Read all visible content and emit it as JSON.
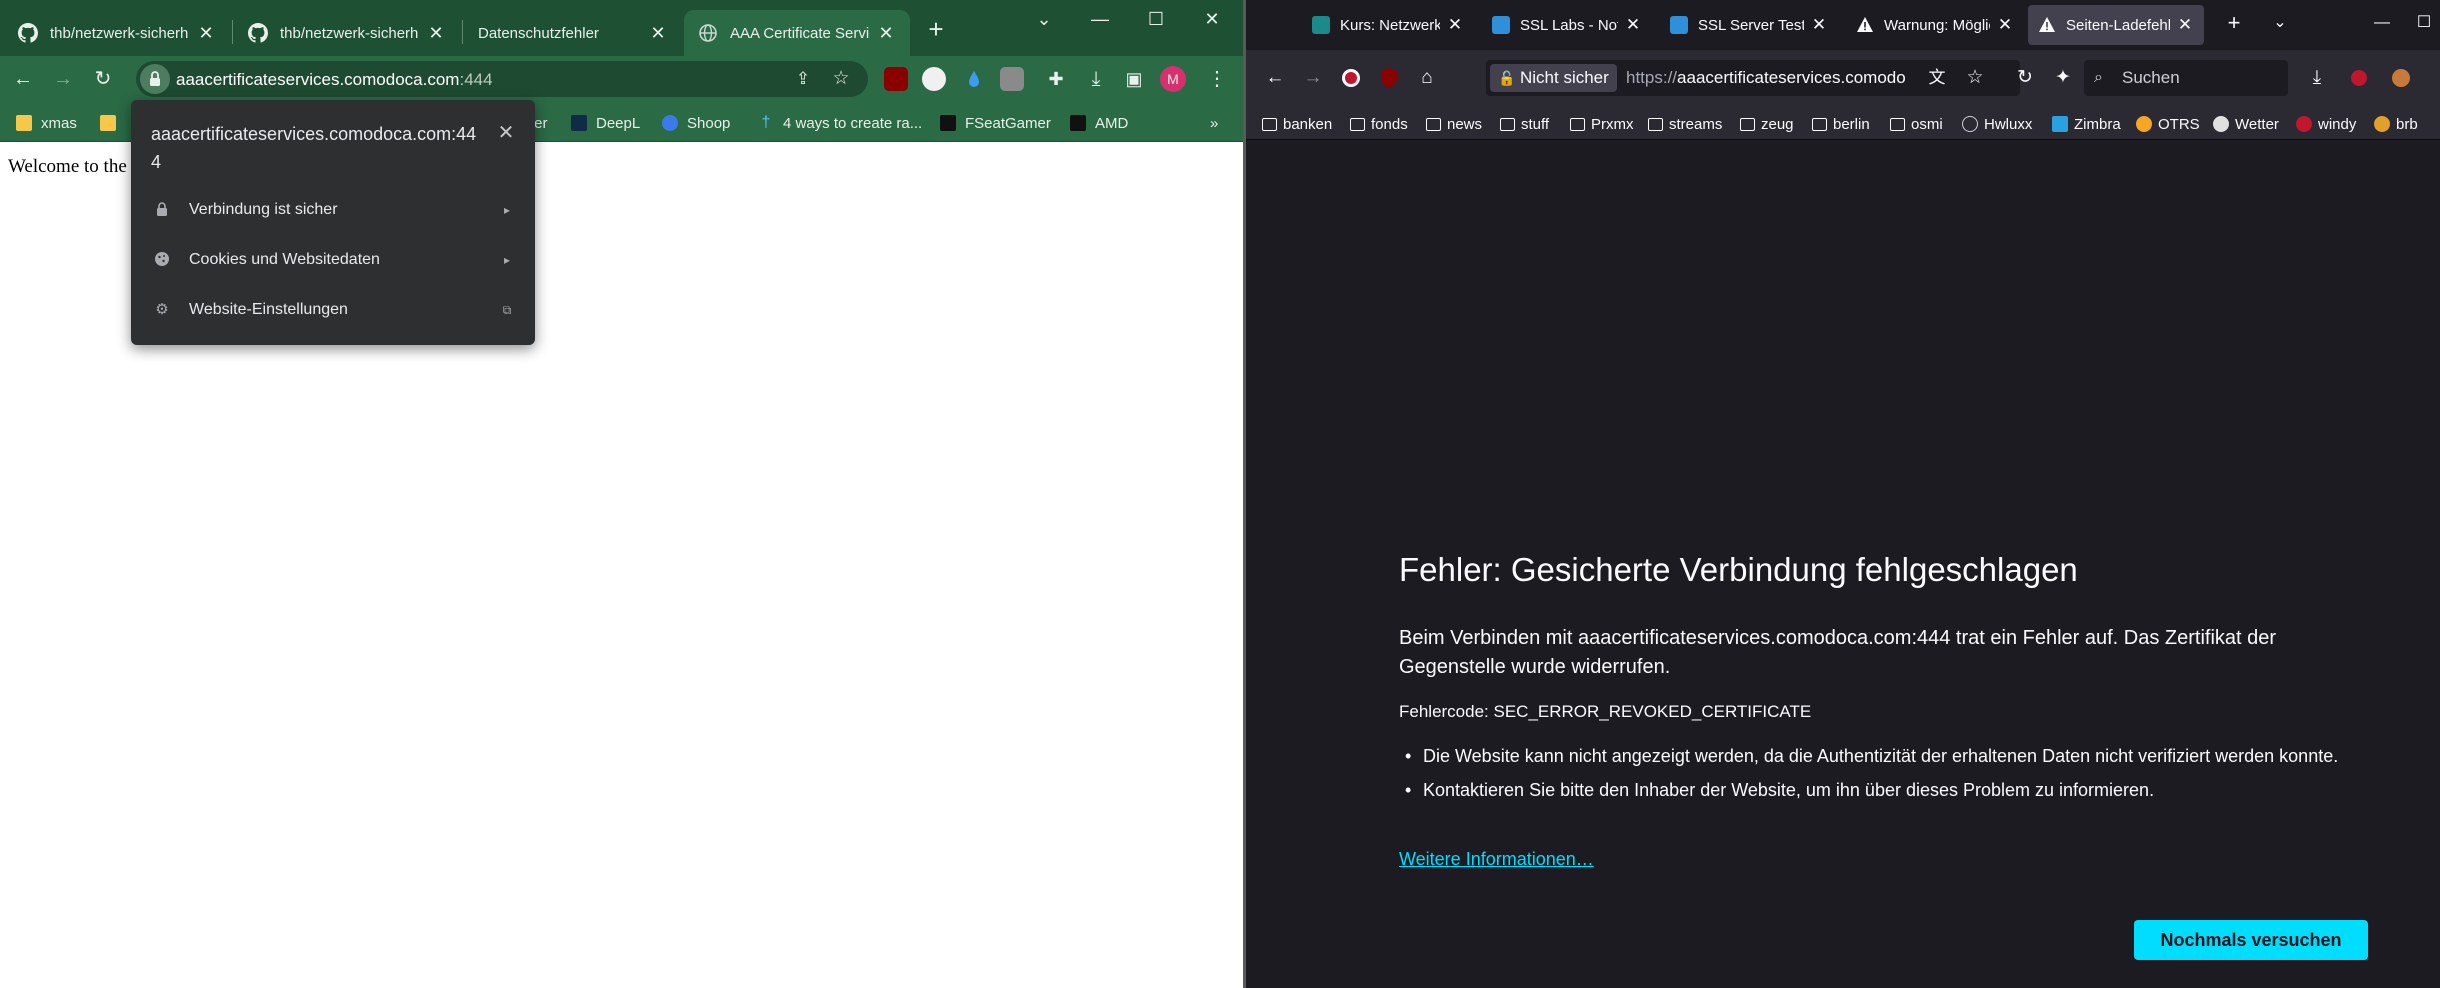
{
  "chrome": {
    "tabs": [
      {
        "title": "thb/netzwerk-sicherh",
        "icon": "github-icon"
      },
      {
        "title": "thb/netzwerk-sicherh",
        "icon": "github-icon"
      },
      {
        "title": "Datenschutzfehler",
        "icon": "none"
      },
      {
        "title": "AAA Certificate Servic",
        "icon": "globe-icon",
        "active": true
      }
    ],
    "window_controls": {
      "minimize": "—",
      "maximize": "☐",
      "close": "✕",
      "dropdown": "⌄"
    },
    "omnibox": {
      "domain": "aaacertificateservices.comodoca.com",
      "port": ":444"
    },
    "profile_initial": "M",
    "bookmarks": [
      {
        "label": "xmas"
      },
      {
        "label": "ter"
      },
      {
        "label": "DeepL"
      },
      {
        "label": "Shoop"
      },
      {
        "label": "4 ways to create ra..."
      },
      {
        "label": "FSeatGamer"
      },
      {
        "label": "AMD"
      }
    ],
    "bookmarks_overflow": "»",
    "page_text": "Welcome to the",
    "site_info_popup": {
      "title": "aaacertificateservices.comodoca.com:444",
      "items": [
        {
          "label": "Verbindung ist sicher",
          "icon": "lock-icon",
          "trail": "▸"
        },
        {
          "label": "Cookies und Websitedaten",
          "icon": "cookie-icon",
          "trail": "▸"
        },
        {
          "label": "Website-Einstellungen",
          "icon": "gear-icon",
          "trail": "⧉"
        }
      ]
    },
    "colors": {
      "frame": "#1e5133",
      "toolbar": "#2a6a45"
    }
  },
  "firefox": {
    "tabs": [
      {
        "title": "Kurs: Netzwerksi",
        "icon_color": "#1a8a8a"
      },
      {
        "title": "SSL Labs - Not A",
        "icon_color": "#2f8fd8"
      },
      {
        "title": "SSL Server Test:",
        "icon_color": "#2f8fd8"
      },
      {
        "title": "Warnung: Möglic",
        "icon": "warning-icon"
      },
      {
        "title": "Seiten-Ladefehle",
        "icon": "warning-icon",
        "active": true
      }
    ],
    "urlbar": {
      "security_label": "Nicht sicher",
      "url_prefix": "https://",
      "url_domain": "aaacertificateservices.comodo"
    },
    "search_placeholder": "Suchen",
    "bookmarks": [
      {
        "label": "banken",
        "type": "folder"
      },
      {
        "label": "fonds",
        "type": "folder"
      },
      {
        "label": "news",
        "type": "folder"
      },
      {
        "label": "stuff",
        "type": "folder"
      },
      {
        "label": "Prxmx",
        "type": "folder"
      },
      {
        "label": "streams",
        "type": "folder"
      },
      {
        "label": "zeug",
        "type": "folder"
      },
      {
        "label": "berlin",
        "type": "folder"
      },
      {
        "label": "osmi",
        "type": "folder"
      },
      {
        "label": "Hwluxx",
        "type": "site",
        "color": "#cfcfd8"
      },
      {
        "label": "Zimbra",
        "type": "site",
        "color": "#2aa0e0"
      },
      {
        "label": "OTRS",
        "type": "site",
        "color": "#f5a623"
      },
      {
        "label": "Wetter",
        "type": "site",
        "color": "#e0e0e0"
      },
      {
        "label": "windy",
        "type": "site",
        "color": "#c0162e"
      },
      {
        "label": "brb",
        "type": "site",
        "color": "#e0a02a"
      }
    ],
    "error": {
      "title": "Fehler: Gesicherte Verbindung fehlgeschlagen",
      "message": "Beim Verbinden mit aaacertificateservices.comodoca.com:444 trat ein Fehler auf. Das Zertifikat der Gegenstelle wurde widerrufen.",
      "code": "Fehlercode: SEC_ERROR_REVOKED_CERTIFICATE",
      "bullets": [
        "Die Website kann nicht angezeigt werden, da die Authentizität der erhaltenen Daten nicht verifiziert werden konnte.",
        "Kontaktieren Sie bitte den Inhaber der Website, um ihn über dieses Problem zu informieren."
      ],
      "more_link": "Weitere Informationen…",
      "retry_button": "Nochmals versuchen"
    },
    "colors": {
      "background": "#1c1b22",
      "toolbar": "#2b2a33",
      "accent": "#00ddff"
    }
  }
}
